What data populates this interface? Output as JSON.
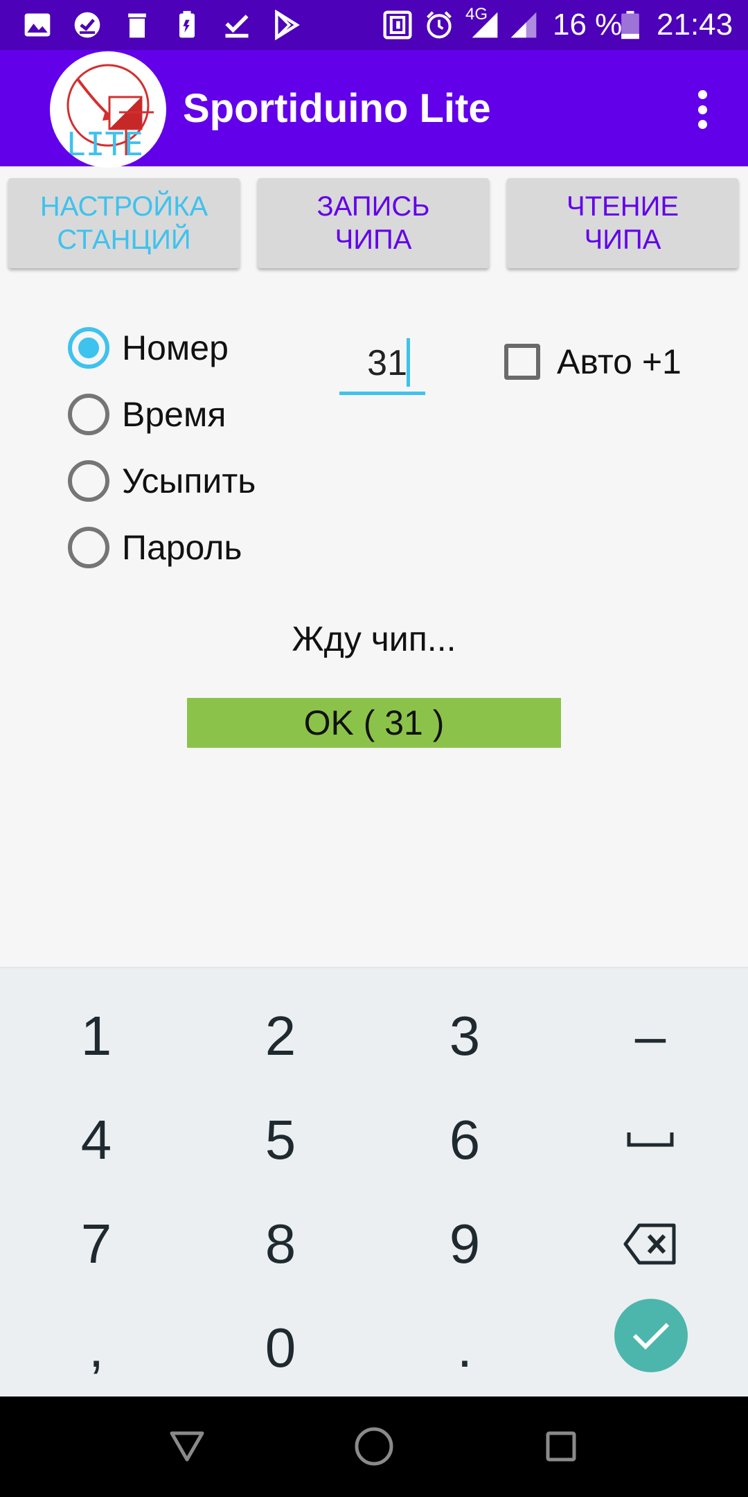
{
  "status_bar": {
    "network": "4G",
    "battery_text": "16 %",
    "time": "21:43",
    "icons": [
      "image-icon",
      "check-circle-icon",
      "trash-icon",
      "battery-saver-icon",
      "download-done-icon",
      "play-store-icon",
      "nfc-icon",
      "alarm-icon",
      "signal-icon",
      "signal-icon-2",
      "battery-icon"
    ]
  },
  "app_bar": {
    "logo_text": "LITE",
    "title": "Sportiduino Lite",
    "menu_icon": "overflow-menu-icon"
  },
  "tabs": [
    {
      "line1": "НАСТРОЙКА",
      "line2": "СТАНЦИЙ"
    },
    {
      "line1": "ЗАПИСЬ",
      "line2": "ЧИПА"
    },
    {
      "line1": "ЧТЕНИЕ",
      "line2": "ЧИПА"
    }
  ],
  "mode_options": [
    {
      "label": "Номер",
      "checked": true
    },
    {
      "label": "Время",
      "checked": false
    },
    {
      "label": "Усыпить",
      "checked": false
    },
    {
      "label": "Пароль",
      "checked": false
    }
  ],
  "number_input": {
    "value": "31"
  },
  "auto_increment": {
    "label": "Авто +1",
    "checked": false
  },
  "status_text": "Жду чип...",
  "result": {
    "text": "OK ( 31 )",
    "color": "#8bc34a"
  },
  "keyboard": {
    "keys": [
      "1",
      "2",
      "3",
      "–",
      "4",
      "5",
      "6",
      "␣",
      "7",
      "8",
      "9",
      "⌫",
      ",",
      "0",
      ".",
      "✓"
    ],
    "space_icon": "space-icon",
    "backspace_icon": "backspace-icon",
    "enter_icon": "check-icon"
  },
  "nav_bar": {
    "icons": [
      "back-icon",
      "home-icon",
      "recents-icon"
    ]
  },
  "colors": {
    "primary": "#6200ea",
    "primary_dark": "#4d01b8",
    "accent": "#3ec2ee",
    "ok": "#8bc34a",
    "enter": "#4db6ac"
  }
}
